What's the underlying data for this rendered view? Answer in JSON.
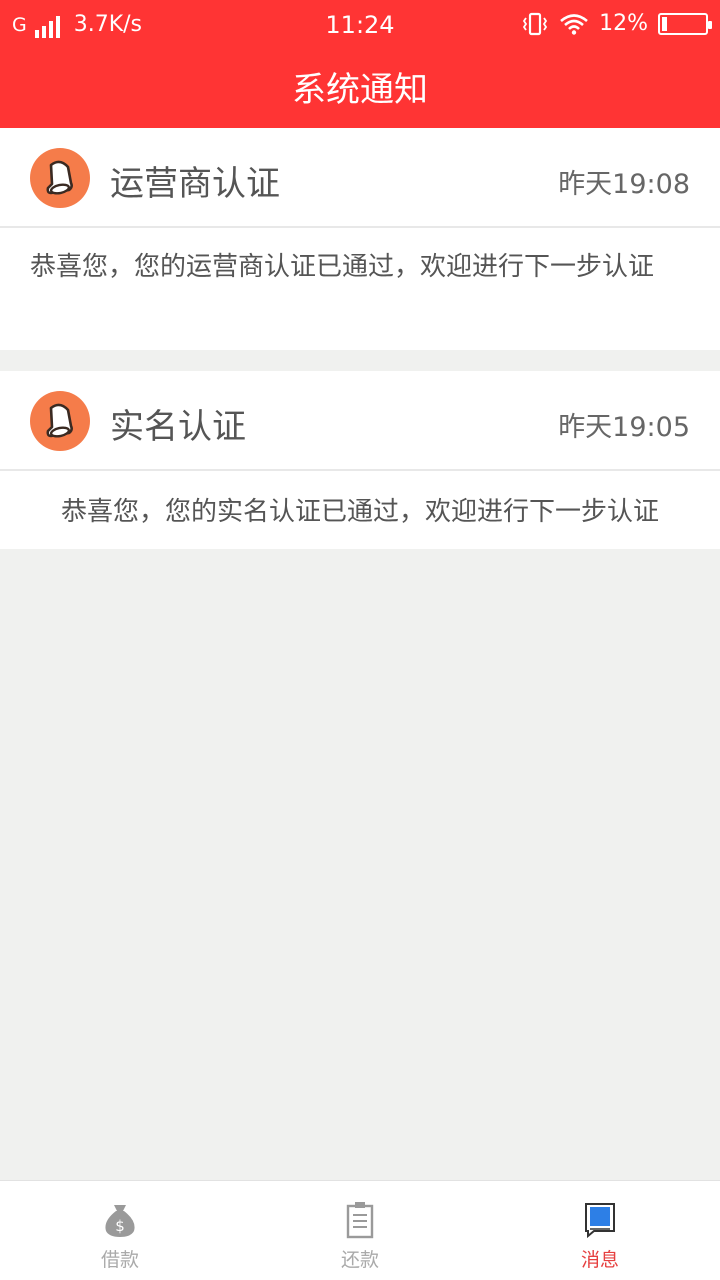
{
  "status_bar": {
    "network_type": "G",
    "speed": "3.7K/s",
    "time": "11:24",
    "battery_text": "12%",
    "battery_level": 0.12
  },
  "header": {
    "title": "系统通知"
  },
  "notifications": [
    {
      "title": "运营商认证",
      "time": "昨天19:08",
      "body": "恭喜您，您的运营商认证已通过，欢迎进行下一步认证",
      "icon": "bell-icon"
    },
    {
      "title": "实名认证",
      "time": "昨天19:05",
      "body": "恭喜您，您的实名认证已通过，欢迎进行下一步认证",
      "icon": "bell-icon"
    }
  ],
  "tabs": [
    {
      "label": "借款",
      "icon": "money-bag-icon",
      "active": false
    },
    {
      "label": "还款",
      "icon": "bill-icon",
      "active": false
    },
    {
      "label": "消息",
      "icon": "message-icon",
      "active": true
    }
  ],
  "colors": {
    "header_red": "#ff3434",
    "bell_orange": "#f57c4a",
    "active_tab": "#e64040",
    "inactive_tab": "#aaaaaa",
    "background": "#f0f1ef"
  }
}
